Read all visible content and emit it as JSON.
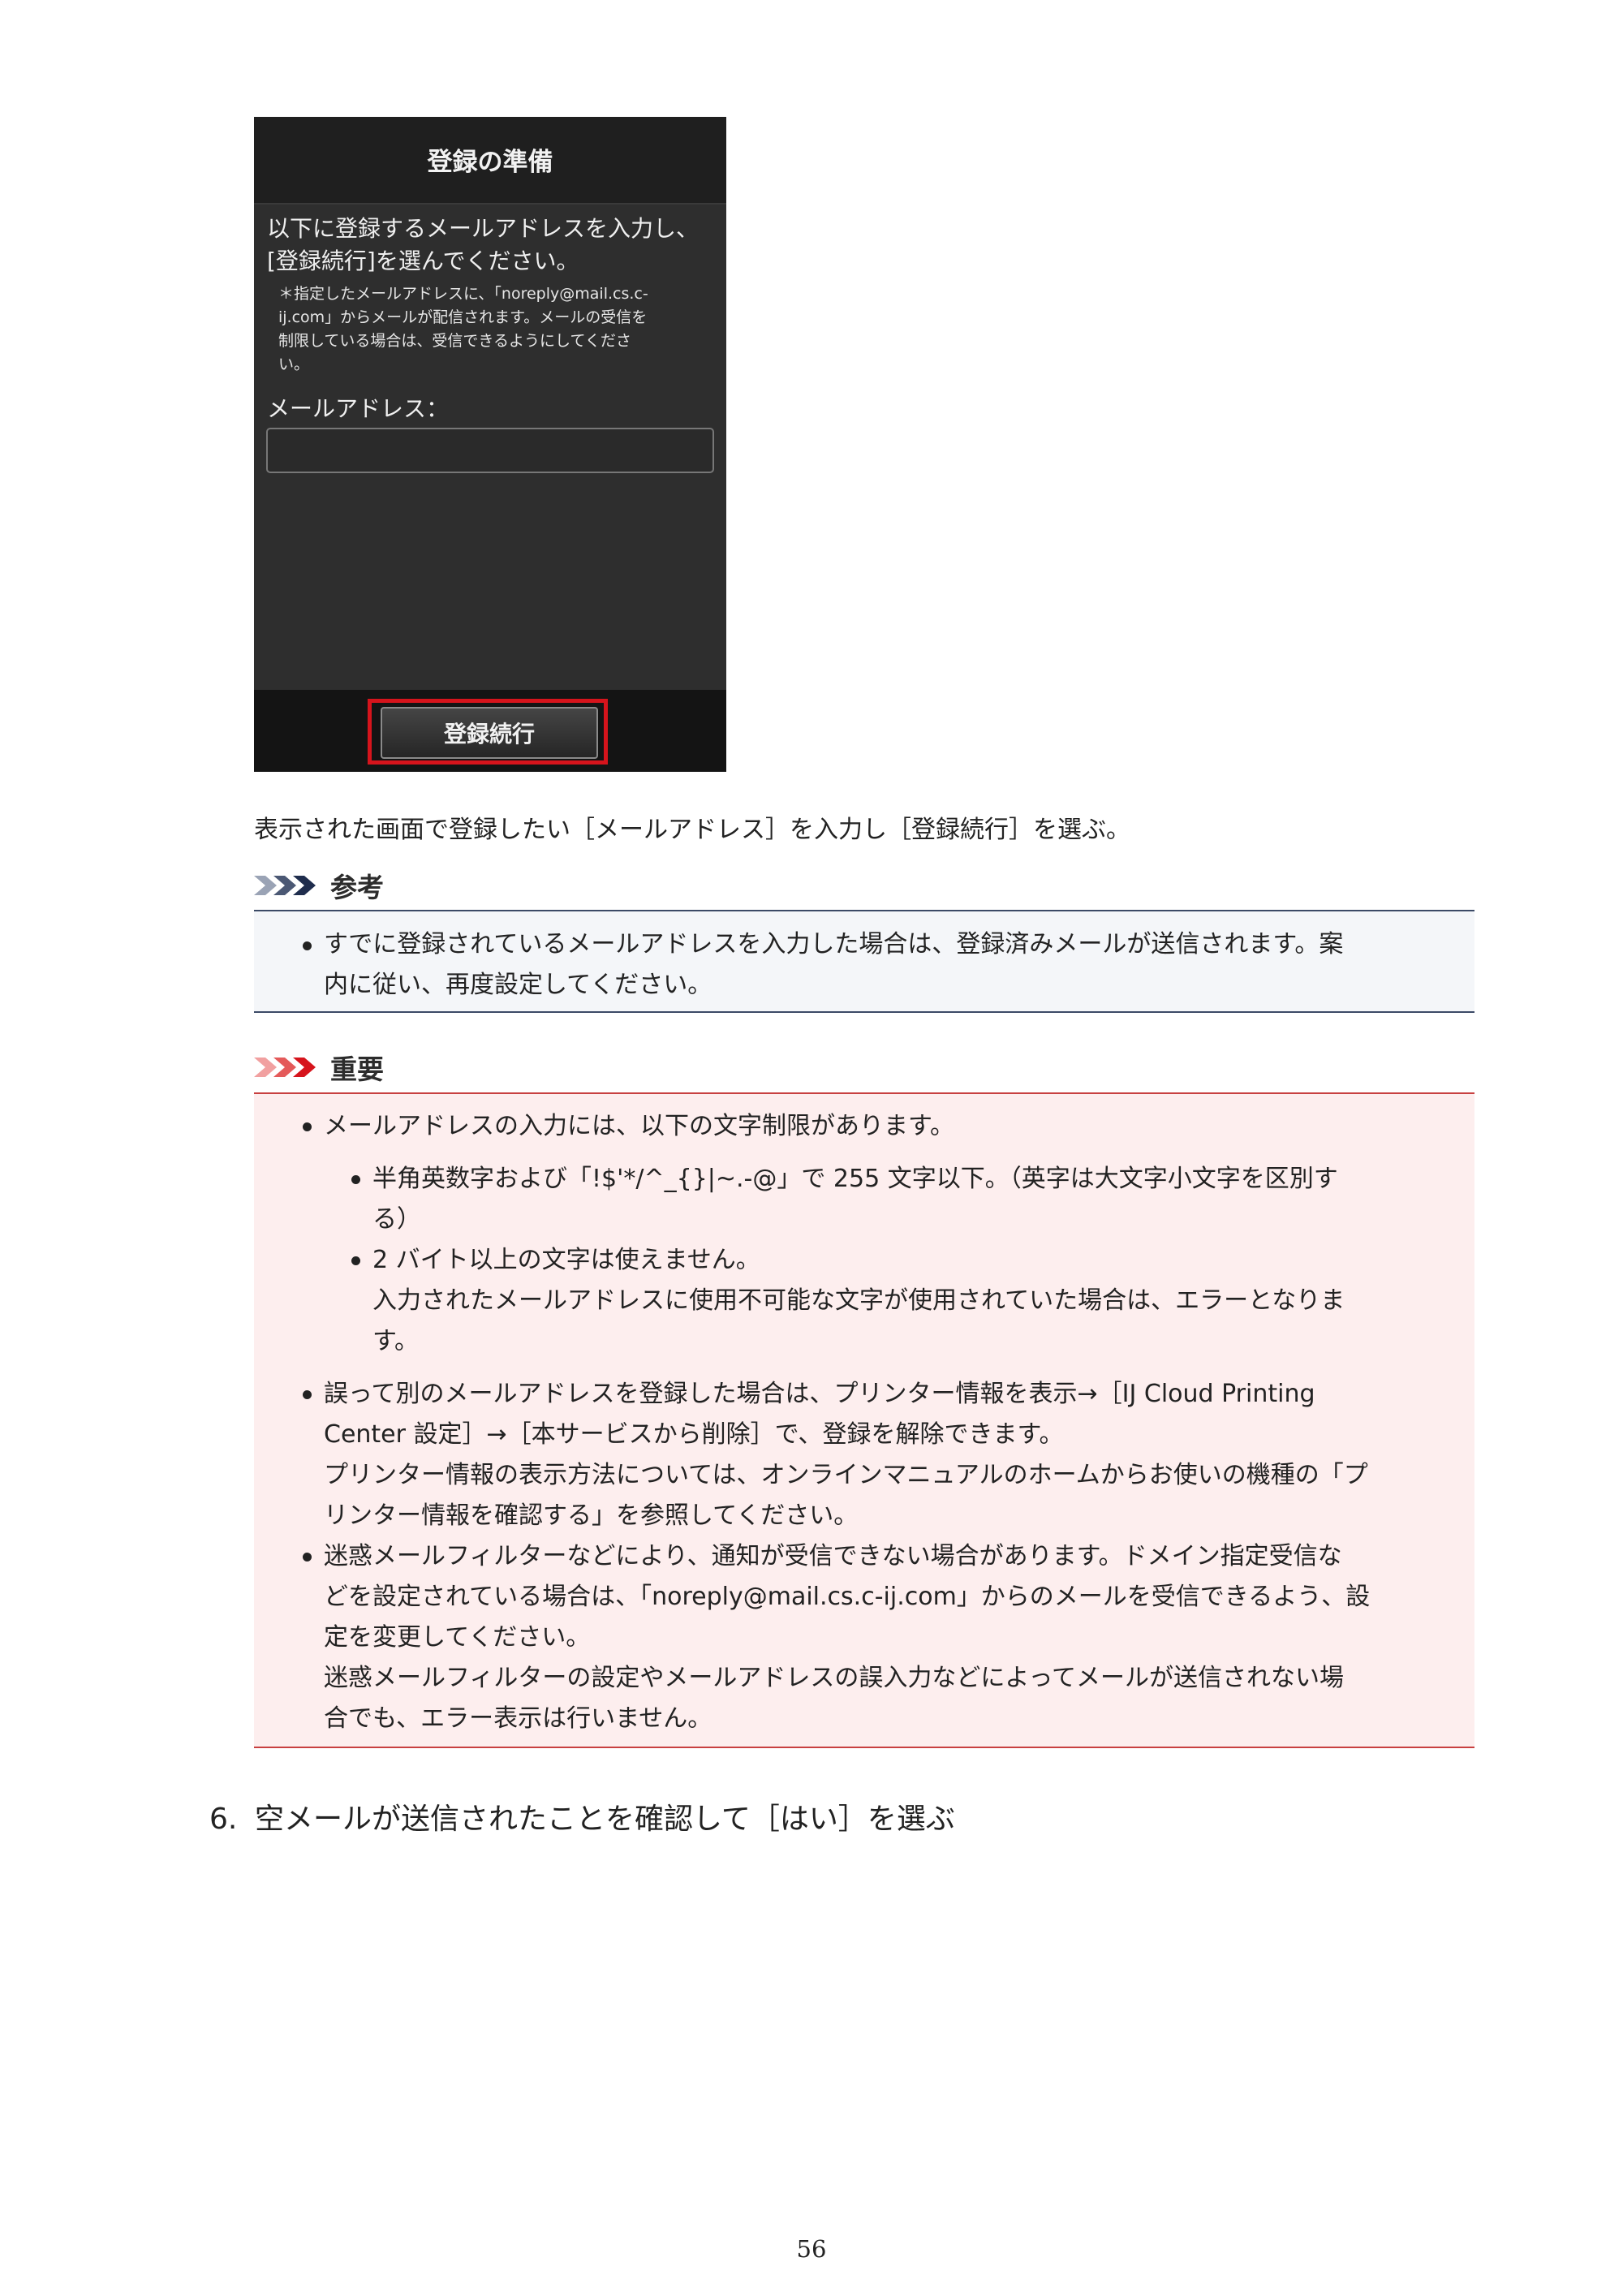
{
  "device": {
    "title": "登録の準備",
    "instruction_line1": "以下に登録するメールアドレスを入力し、",
    "instruction_line2": "[登録続行]を選んでください。",
    "note_line1": "＊指定したメールアドレスに、「noreply@mail.cs.c-",
    "note_line2": "ij.com」からメールが配信されます。メールの受信を",
    "note_line3": "制限している場合は、受信できるようにしてくださ",
    "note_line4": "い。",
    "email_label": "メールアドレス：",
    "email_value": "",
    "continue_button": "登録続行"
  },
  "caption": "表示された画面で登録したい［メールアドレス］を入力し［登録続行］を選ぶ。",
  "reference": {
    "heading": "参考",
    "item1_line1": "すでに登録されているメールアドレスを入力した場合は、登録済みメールが送信されます。案",
    "item1_line2": "内に従い、再度設定してください。"
  },
  "important": {
    "heading": "重要",
    "item1": "メールアドレスの入力には、以下の文字制限があります。",
    "sub1_line1": "半角英数字および「!$'*/^_{}|~.-@」で 255 文字以下。（英字は大文字小文字を区別す",
    "sub1_line2": "る）",
    "sub2_line1": "2 バイト以上の文字は使えません。",
    "sub2_line2": "入力されたメールアドレスに使用不可能な文字が使用されていた場合は、エラーとなりま",
    "sub2_line3": "す。",
    "item2_line1": "誤って別のメールアドレスを登録した場合は、プリンター情報を表示→［IJ Cloud Printing",
    "item2_line2": "Center 設定］→［本サービスから削除］で、登録を解除できます。",
    "item2_line3": "プリンター情報の表示方法については、オンラインマニュアルのホームからお使いの機種の「プ",
    "item2_line4": "リンター情報を確認する」を参照してください。",
    "item3_line1": "迷惑メールフィルターなどにより、通知が受信できない場合があります。ドメイン指定受信な",
    "item3_line2": "どを設定されている場合は、「noreply@mail.cs.c-ij.com」からのメールを受信できるよう、設",
    "item3_line3": "定を変更してください。",
    "item3_line4": "迷惑メールフィルターの設定やメールアドレスの誤入力などによってメールが送信されない場",
    "item3_line5": "合でも、エラー表示は行いません。"
  },
  "step": {
    "number": "6.",
    "text": "空メールが送信されたことを確認して［はい］を選ぶ"
  },
  "page_number": "56",
  "colors": {
    "reference_accent": "#1f2d4d",
    "important_accent": "#d6141c",
    "important_background": "#fdeeee",
    "reference_background": "#f4f6f9"
  },
  "icons": {
    "reference": "triple-chevron-dark-icon",
    "important": "triple-chevron-red-icon"
  }
}
